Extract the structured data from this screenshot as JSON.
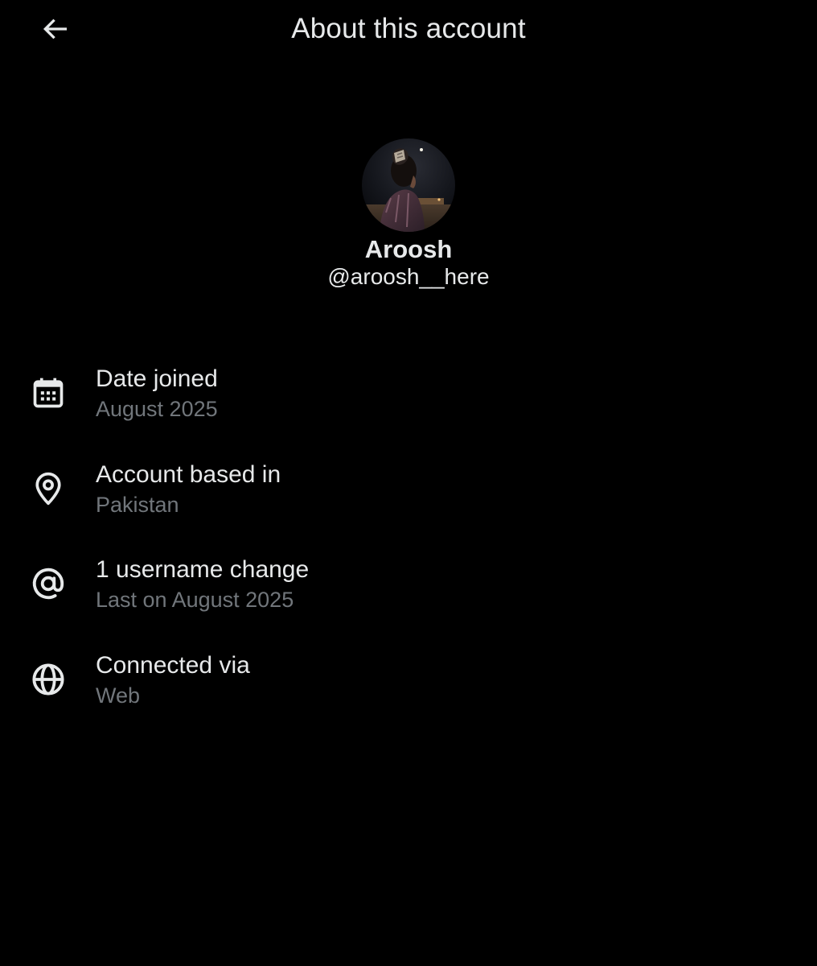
{
  "header": {
    "title": "About this account",
    "back_icon": "arrow-left-icon"
  },
  "profile": {
    "display_name": "Aroosh",
    "handle": "@aroosh__here"
  },
  "rows": [
    {
      "icon": "calendar-icon",
      "label": "Date joined",
      "value": "August 2025"
    },
    {
      "icon": "location-pin-icon",
      "label": "Account based in",
      "value": "Pakistan"
    },
    {
      "icon": "at-sign-icon",
      "label": "1 username change",
      "value": "Last on August 2025"
    },
    {
      "icon": "globe-icon",
      "label": "Connected via",
      "value": "Web"
    }
  ],
  "colors": {
    "background": "#000000",
    "primary_text": "#e7e9ea",
    "secondary_text": "#71767b"
  }
}
